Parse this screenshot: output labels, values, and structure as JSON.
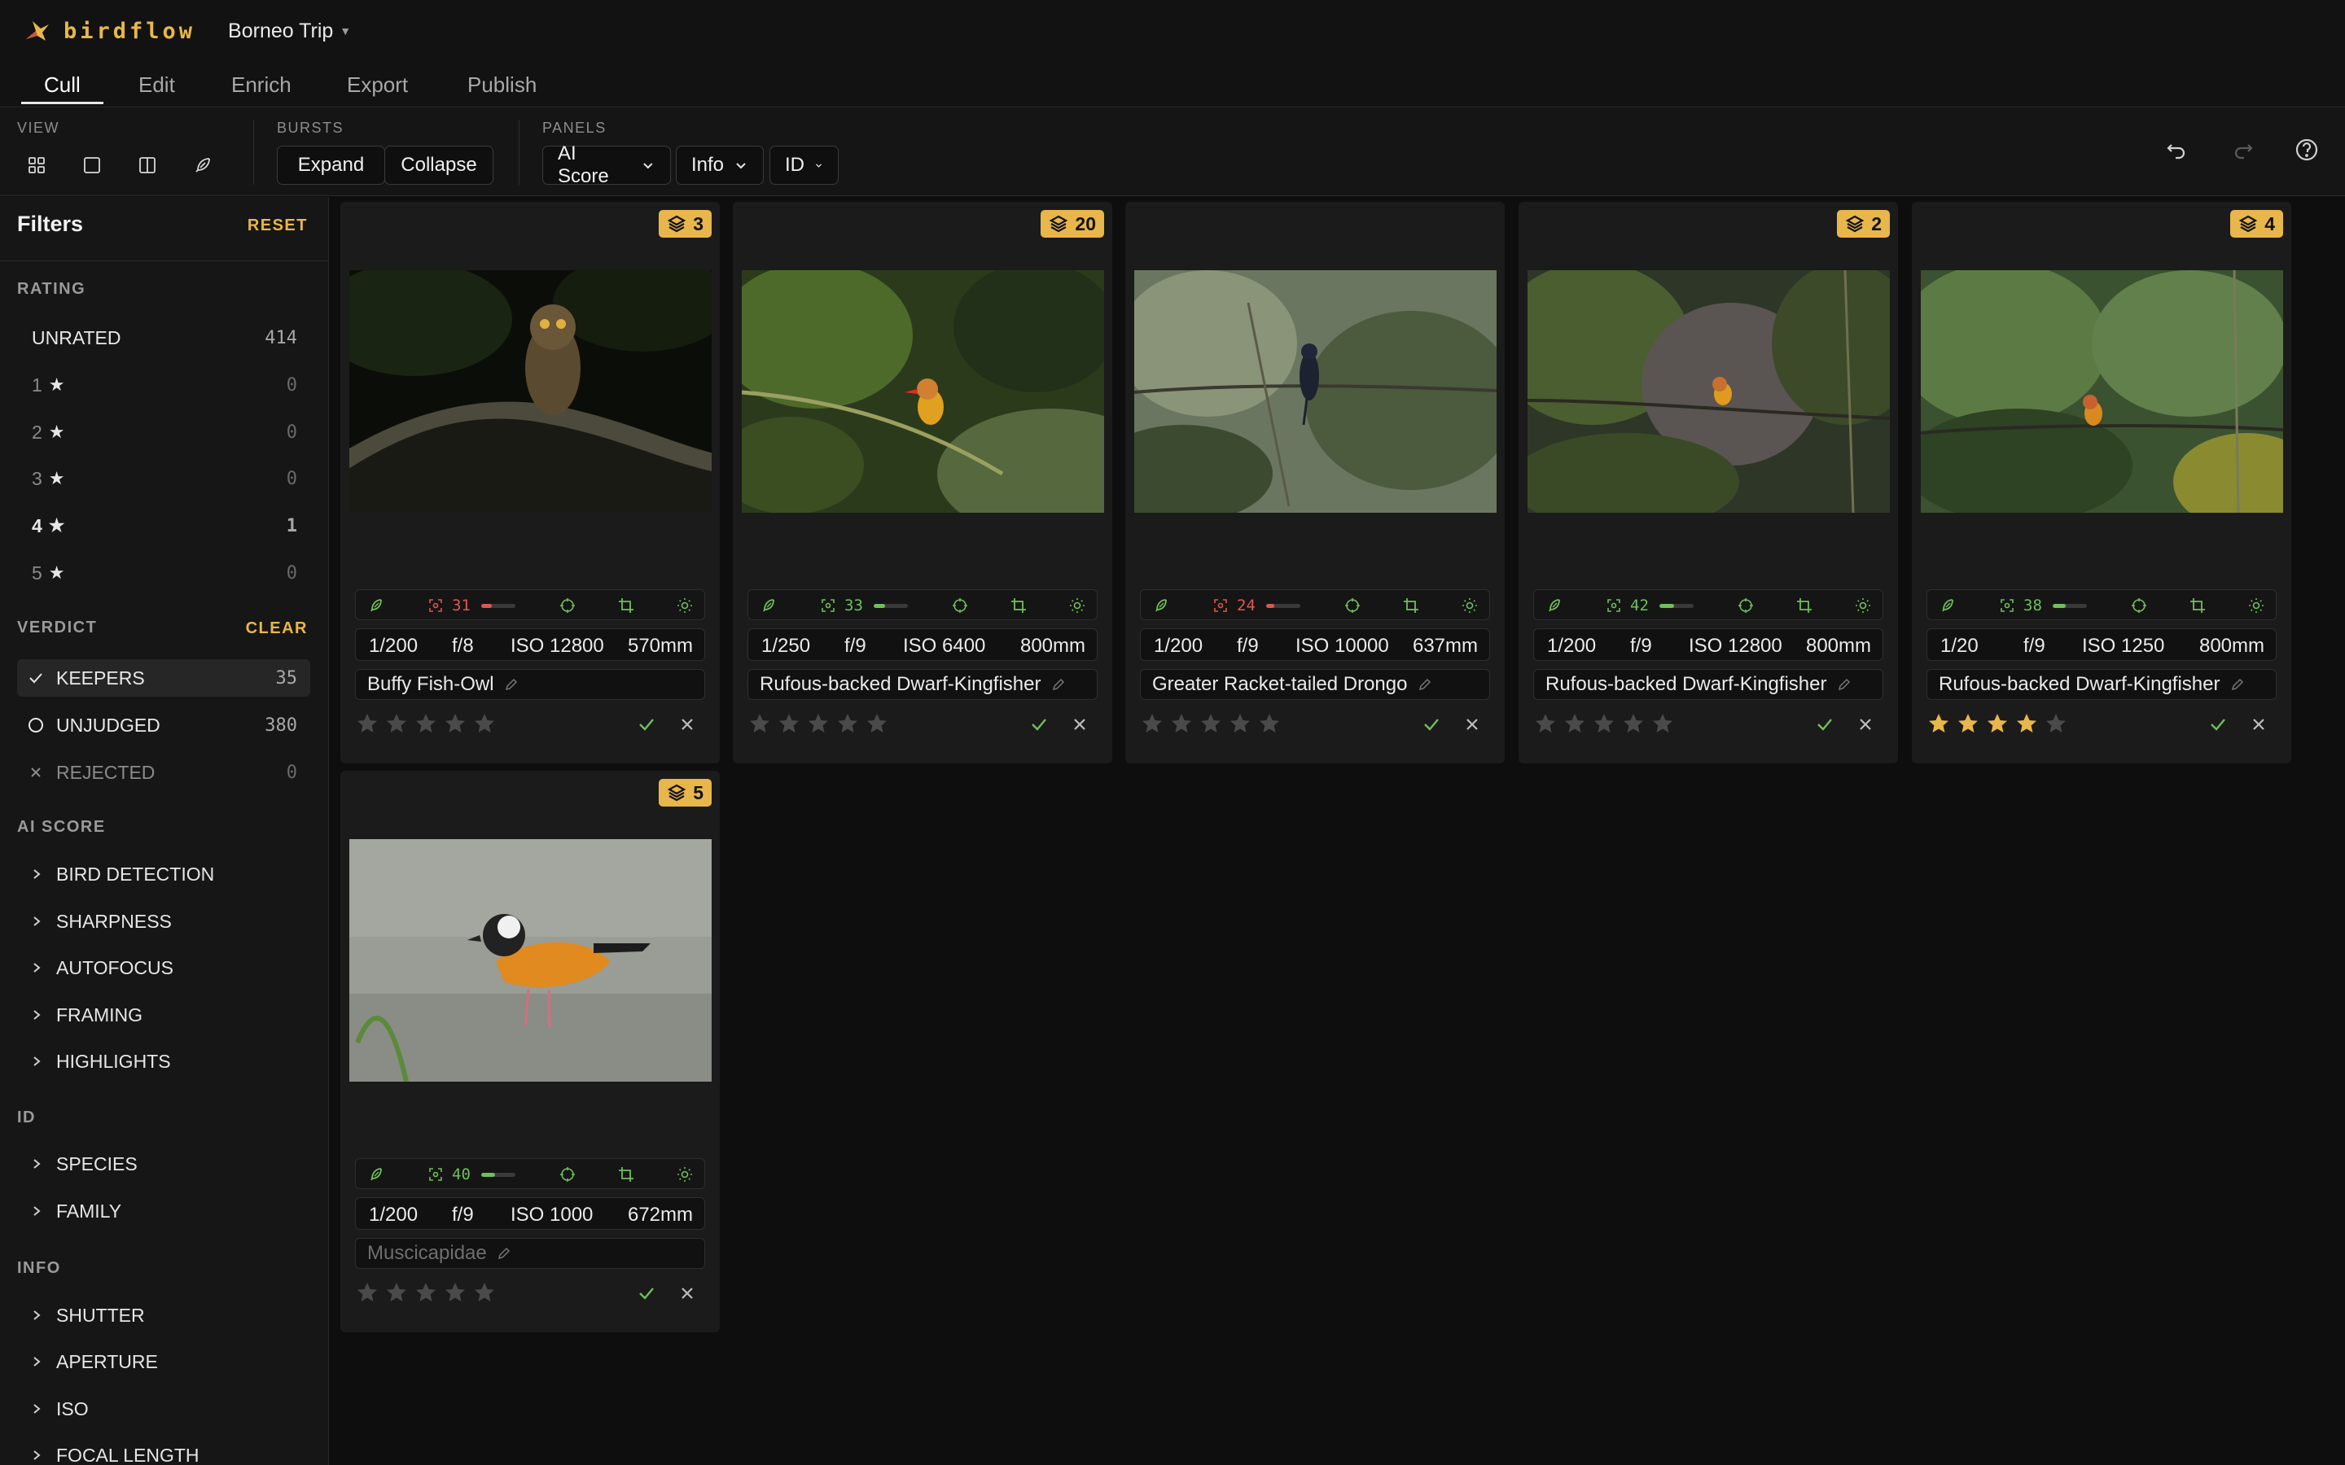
{
  "app": {
    "name": "birdflow",
    "project": "Borneo Trip"
  },
  "tabs": [
    "Cull",
    "Edit",
    "Enrich",
    "Export",
    "Publish"
  ],
  "toolbar": {
    "view_label": "VIEW",
    "bursts_label": "BURSTS",
    "expand_label": "Expand",
    "collapse_label": "Collapse",
    "panels_label": "PANELS",
    "panels": [
      "AI Score",
      "Info",
      "ID"
    ]
  },
  "sidebar": {
    "title": "Filters",
    "reset": "RESET",
    "rating_label": "RATING",
    "rating": [
      {
        "label": "UNRATED",
        "count": "414"
      },
      {
        "label": "1",
        "count": "0"
      },
      {
        "label": "2",
        "count": "0"
      },
      {
        "label": "3",
        "count": "0"
      },
      {
        "label": "4",
        "count": "1"
      },
      {
        "label": "5",
        "count": "0"
      }
    ],
    "verdict_label": "VERDICT",
    "verdict_clear": "CLEAR",
    "verdict": [
      {
        "label": "KEEPERS",
        "count": "35"
      },
      {
        "label": "UNJUDGED",
        "count": "380"
      },
      {
        "label": "REJECTED",
        "count": "0"
      }
    ],
    "ai_label": "AI SCORE",
    "ai_items": [
      "BIRD DETECTION",
      "SHARPNESS",
      "AUTOFOCUS",
      "FRAMING",
      "HIGHLIGHTS"
    ],
    "id_label": "ID",
    "id_items": [
      "SPECIES",
      "FAMILY"
    ],
    "info_label": "INFO",
    "info_items": [
      "SHUTTER",
      "APERTURE",
      "ISO",
      "FOCAL LENGTH"
    ]
  },
  "cards": [
    {
      "burst": "3",
      "score": "31",
      "score_level": 0.31,
      "score_color": "#e0564f",
      "shutter": "1/200",
      "aperture": "f/8",
      "iso": "ISO 12800",
      "focal": "570mm",
      "species": "Buffy Fish-Owl",
      "rating": 0,
      "scene": "owl"
    },
    {
      "burst": "20",
      "score": "33",
      "score_level": 0.33,
      "score_color": "#6fbf5a",
      "shutter": "1/250",
      "aperture": "f/9",
      "iso": "ISO 6400",
      "focal": "800mm",
      "species": "Rufous-backed Dwarf-Kingfisher",
      "rating": 0,
      "scene": "kingfisher1"
    },
    {
      "burst": "",
      "score": "24",
      "score_level": 0.24,
      "score_color": "#e0564f",
      "shutter": "1/200",
      "aperture": "f/9",
      "iso": "ISO 10000",
      "focal": "637mm",
      "species": "Greater Racket-tailed Drongo",
      "rating": 0,
      "scene": "drongo"
    },
    {
      "burst": "2",
      "score": "42",
      "score_level": 0.42,
      "score_color": "#6fbf5a",
      "shutter": "1/200",
      "aperture": "f/9",
      "iso": "ISO 12800",
      "focal": "800mm",
      "species": "Rufous-backed Dwarf-Kingfisher",
      "rating": 0,
      "scene": "kingfisher2"
    },
    {
      "burst": "4",
      "score": "38",
      "score_level": 0.38,
      "score_color": "#6fbf5a",
      "shutter": "1/20",
      "aperture": "f/9",
      "iso": "ISO 1250",
      "focal": "800mm",
      "species": "Rufous-backed Dwarf-Kingfisher",
      "rating": 4,
      "scene": "kingfisher3"
    },
    {
      "burst": "5",
      "score": "40",
      "score_level": 0.4,
      "score_color": "#6fbf5a",
      "shutter": "1/200",
      "aperture": "f/9",
      "iso": "ISO 1000",
      "focal": "672mm",
      "species": "Muscicapidae",
      "species_placeholder": true,
      "rating": 0,
      "scene": "flycatcher"
    }
  ],
  "colors": {
    "accent": "#e8b64a",
    "keep": "#6fbf5a",
    "reject": "#e0564f"
  }
}
